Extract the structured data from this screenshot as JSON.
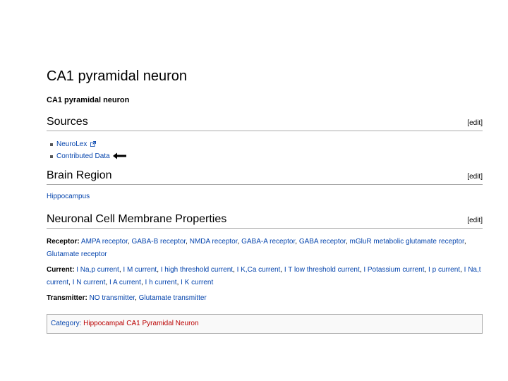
{
  "page": {
    "title": "CA1 pyramidal neuron",
    "subtitle": "CA1 pyramidal neuron"
  },
  "edit_label": "[edit]",
  "sources": {
    "heading": "Sources",
    "items": [
      "NeuroLex",
      "Contributed Data"
    ]
  },
  "brain_region": {
    "heading": "Brain Region",
    "value": "Hippocampus"
  },
  "membrane": {
    "heading": "Neuronal Cell Membrane Properties",
    "receptor_label": "Receptor:",
    "receptor_items": [
      "AMPA receptor",
      "GABA-B receptor",
      "NMDA receptor",
      "GABA-A receptor",
      "GABA receptor",
      "mGluR metabolic glutamate receptor",
      "Glutamate receptor"
    ],
    "current_label": "Current:",
    "current_items": [
      "I Na,p current",
      "I M current",
      "I high threshold current",
      "I K,Ca current",
      "I T low threshold current",
      "I Potassium current",
      "I p current",
      "I Na,t current",
      "I N current",
      "I A current",
      "I h current",
      "I K current"
    ],
    "transmitter_label": "Transmitter:",
    "transmitter_items": [
      "NO transmitter",
      "Glutamate transmitter"
    ]
  },
  "category": {
    "label": "Category:",
    "value": "Hippocampal CA1 Pyramidal Neuron"
  },
  "colors": {
    "link": "#0645ad",
    "redlink": "#ba0000",
    "rule": "#aaaaaa"
  }
}
